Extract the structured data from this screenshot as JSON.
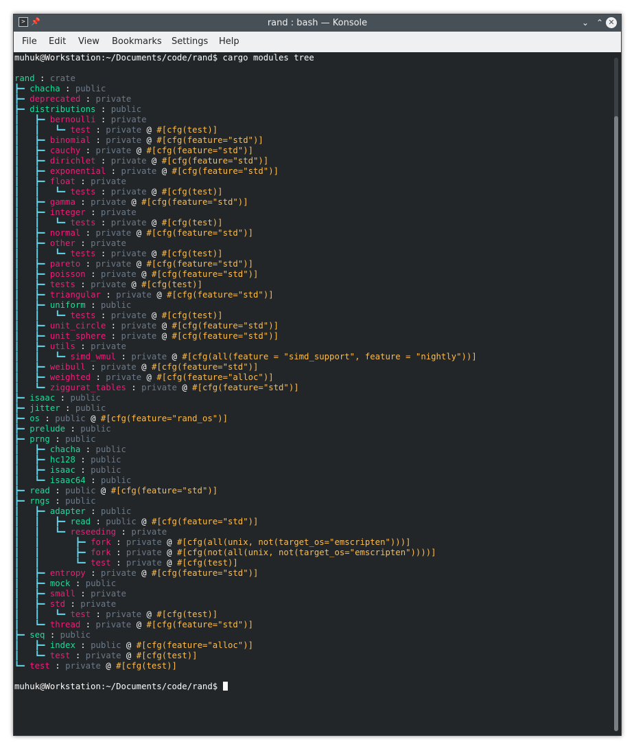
{
  "window": {
    "title": "rand : bash — Konsole",
    "icons": {
      "app": "terminal-icon",
      "pin": "pin-icon",
      "minimize": "chevron-down-icon",
      "maximize": "chevron-up-icon",
      "close": "close-icon"
    }
  },
  "menubar": {
    "items": [
      "File",
      "Edit",
      "View",
      "Bookmarks",
      "Settings",
      "Help"
    ]
  },
  "terminal": {
    "prompt": "muhuk@Workstation:~/Documents/code/rand$",
    "command": "cargo modules tree",
    "final_prompt": "muhuk@Workstation:~/Documents/code/rand$",
    "tree": [
      {
        "indent": "",
        "branch": "",
        "name": "rand",
        "vis": "crate",
        "attr": ""
      },
      {
        "indent": "",
        "branch": "┣━ ",
        "name": "chacha",
        "vis": "public",
        "attr": ""
      },
      {
        "indent": "",
        "branch": "┣━ ",
        "name": "deprecated",
        "vis": "private",
        "attr": ""
      },
      {
        "indent": "",
        "branch": "┣━ ",
        "name": "distributions",
        "vis": "public",
        "attr": ""
      },
      {
        "indent": "┃   ",
        "branch": "┣━ ",
        "name": "bernoulli",
        "vis": "private",
        "attr": ""
      },
      {
        "indent": "┃   ┃   ",
        "branch": "┗━ ",
        "name": "test",
        "vis": "private",
        "attr": "#[cfg(test)]"
      },
      {
        "indent": "┃   ",
        "branch": "┣━ ",
        "name": "binomial",
        "vis": "private",
        "attr": "#[cfg(feature=\"std\")]"
      },
      {
        "indent": "┃   ",
        "branch": "┣━ ",
        "name": "cauchy",
        "vis": "private",
        "attr": "#[cfg(feature=\"std\")]"
      },
      {
        "indent": "┃   ",
        "branch": "┣━ ",
        "name": "dirichlet",
        "vis": "private",
        "attr": "#[cfg(feature=\"std\")]"
      },
      {
        "indent": "┃   ",
        "branch": "┣━ ",
        "name": "exponential",
        "vis": "private",
        "attr": "#[cfg(feature=\"std\")]"
      },
      {
        "indent": "┃   ",
        "branch": "┣━ ",
        "name": "float",
        "vis": "private",
        "attr": ""
      },
      {
        "indent": "┃   ┃   ",
        "branch": "┗━ ",
        "name": "tests",
        "vis": "private",
        "attr": "#[cfg(test)]"
      },
      {
        "indent": "┃   ",
        "branch": "┣━ ",
        "name": "gamma",
        "vis": "private",
        "attr": "#[cfg(feature=\"std\")]"
      },
      {
        "indent": "┃   ",
        "branch": "┣━ ",
        "name": "integer",
        "vis": "private",
        "attr": ""
      },
      {
        "indent": "┃   ┃   ",
        "branch": "┗━ ",
        "name": "tests",
        "vis": "private",
        "attr": "#[cfg(test)]"
      },
      {
        "indent": "┃   ",
        "branch": "┣━ ",
        "name": "normal",
        "vis": "private",
        "attr": "#[cfg(feature=\"std\")]"
      },
      {
        "indent": "┃   ",
        "branch": "┣━ ",
        "name": "other",
        "vis": "private",
        "attr": ""
      },
      {
        "indent": "┃   ┃   ",
        "branch": "┗━ ",
        "name": "tests",
        "vis": "private",
        "attr": "#[cfg(test)]"
      },
      {
        "indent": "┃   ",
        "branch": "┣━ ",
        "name": "pareto",
        "vis": "private",
        "attr": "#[cfg(feature=\"std\")]"
      },
      {
        "indent": "┃   ",
        "branch": "┣━ ",
        "name": "poisson",
        "vis": "private",
        "attr": "#[cfg(feature=\"std\")]"
      },
      {
        "indent": "┃   ",
        "branch": "┣━ ",
        "name": "tests",
        "vis": "private",
        "attr": "#[cfg(test)]"
      },
      {
        "indent": "┃   ",
        "branch": "┣━ ",
        "name": "triangular",
        "vis": "private",
        "attr": "#[cfg(feature=\"std\")]"
      },
      {
        "indent": "┃   ",
        "branch": "┣━ ",
        "name": "uniform",
        "vis": "public",
        "attr": ""
      },
      {
        "indent": "┃   ┃   ",
        "branch": "┗━ ",
        "name": "tests",
        "vis": "private",
        "attr": "#[cfg(test)]"
      },
      {
        "indent": "┃   ",
        "branch": "┣━ ",
        "name": "unit_circle",
        "vis": "private",
        "attr": "#[cfg(feature=\"std\")]"
      },
      {
        "indent": "┃   ",
        "branch": "┣━ ",
        "name": "unit_sphere",
        "vis": "private",
        "attr": "#[cfg(feature=\"std\")]"
      },
      {
        "indent": "┃   ",
        "branch": "┣━ ",
        "name": "utils",
        "vis": "private",
        "attr": ""
      },
      {
        "indent": "┃   ┃   ",
        "branch": "┗━ ",
        "name": "simd_wmul",
        "vis": "private",
        "attr": "#[cfg(all(feature = \"simd_support\", feature = \"nightly\"))]"
      },
      {
        "indent": "┃   ",
        "branch": "┣━ ",
        "name": "weibull",
        "vis": "private",
        "attr": "#[cfg(feature=\"std\")]"
      },
      {
        "indent": "┃   ",
        "branch": "┣━ ",
        "name": "weighted",
        "vis": "private",
        "attr": "#[cfg(feature=\"alloc\")]"
      },
      {
        "indent": "┃   ",
        "branch": "┗━ ",
        "name": "ziggurat_tables",
        "vis": "private",
        "attr": "#[cfg(feature=\"std\")]"
      },
      {
        "indent": "",
        "branch": "┣━ ",
        "name": "isaac",
        "vis": "public",
        "attr": ""
      },
      {
        "indent": "",
        "branch": "┣━ ",
        "name": "jitter",
        "vis": "public",
        "attr": ""
      },
      {
        "indent": "",
        "branch": "┣━ ",
        "name": "os",
        "vis": "public",
        "attr": "#[cfg(feature=\"rand_os\")]"
      },
      {
        "indent": "",
        "branch": "┣━ ",
        "name": "prelude",
        "vis": "public",
        "attr": ""
      },
      {
        "indent": "",
        "branch": "┣━ ",
        "name": "prng",
        "vis": "public",
        "attr": ""
      },
      {
        "indent": "┃   ",
        "branch": "┣━ ",
        "name": "chacha",
        "vis": "public",
        "attr": ""
      },
      {
        "indent": "┃   ",
        "branch": "┣━ ",
        "name": "hc128",
        "vis": "public",
        "attr": ""
      },
      {
        "indent": "┃   ",
        "branch": "┣━ ",
        "name": "isaac",
        "vis": "public",
        "attr": ""
      },
      {
        "indent": "┃   ",
        "branch": "┗━ ",
        "name": "isaac64",
        "vis": "public",
        "attr": ""
      },
      {
        "indent": "",
        "branch": "┣━ ",
        "name": "read",
        "vis": "public",
        "attr": "#[cfg(feature=\"std\")]"
      },
      {
        "indent": "",
        "branch": "┣━ ",
        "name": "rngs",
        "vis": "public",
        "attr": ""
      },
      {
        "indent": "┃   ",
        "branch": "┣━ ",
        "name": "adapter",
        "vis": "public",
        "attr": ""
      },
      {
        "indent": "┃   ┃   ",
        "branch": "┣━ ",
        "name": "read",
        "vis": "public",
        "attr": "#[cfg(feature=\"std\")]"
      },
      {
        "indent": "┃   ┃   ",
        "branch": "┗━ ",
        "name": "reseeding",
        "vis": "private",
        "attr": ""
      },
      {
        "indent": "┃   ┃       ",
        "branch": "┣━ ",
        "name": "fork",
        "vis": "private",
        "attr": "#[cfg(all(unix, not(target_os=\"emscripten\")))]"
      },
      {
        "indent": "┃   ┃       ",
        "branch": "┣━ ",
        "name": "fork",
        "vis": "private",
        "attr": "#[cfg(not(all(unix, not(target_os=\"emscripten\"))))]"
      },
      {
        "indent": "┃   ┃       ",
        "branch": "┗━ ",
        "name": "test",
        "vis": "private",
        "attr": "#[cfg(test)]"
      },
      {
        "indent": "┃   ",
        "branch": "┣━ ",
        "name": "entropy",
        "vis": "private",
        "attr": "#[cfg(feature=\"std\")]"
      },
      {
        "indent": "┃   ",
        "branch": "┣━ ",
        "name": "mock",
        "vis": "public",
        "attr": ""
      },
      {
        "indent": "┃   ",
        "branch": "┣━ ",
        "name": "small",
        "vis": "private",
        "attr": ""
      },
      {
        "indent": "┃   ",
        "branch": "┣━ ",
        "name": "std",
        "vis": "private",
        "attr": ""
      },
      {
        "indent": "┃   ┃   ",
        "branch": "┗━ ",
        "name": "test",
        "vis": "private",
        "attr": "#[cfg(test)]"
      },
      {
        "indent": "┃   ",
        "branch": "┗━ ",
        "name": "thread",
        "vis": "private",
        "attr": "#[cfg(feature=\"std\")]"
      },
      {
        "indent": "",
        "branch": "┣━ ",
        "name": "seq",
        "vis": "public",
        "attr": ""
      },
      {
        "indent": "┃   ",
        "branch": "┣━ ",
        "name": "index",
        "vis": "public",
        "attr": "#[cfg(feature=\"alloc\")]"
      },
      {
        "indent": "┃   ",
        "branch": "┗━ ",
        "name": "test",
        "vis": "private",
        "attr": "#[cfg(test)]"
      },
      {
        "indent": "",
        "branch": "┗━ ",
        "name": "test",
        "vis": "private",
        "attr": "#[cfg(test)]"
      }
    ]
  }
}
